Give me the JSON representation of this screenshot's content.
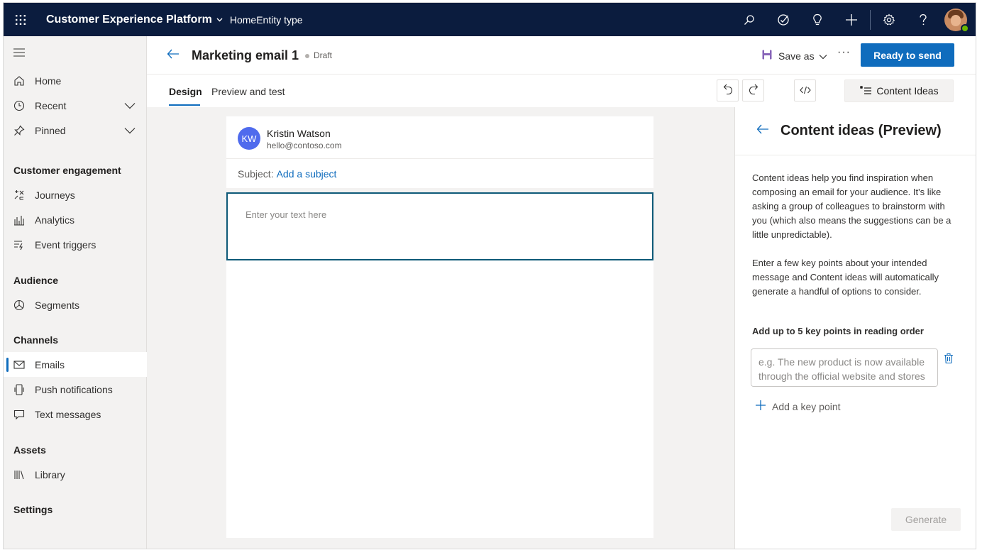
{
  "topbar": {
    "app_title": "Customer Experience Platform",
    "breadcrumb": "HomeEntity type",
    "colors": {
      "background": "#0b1c3e"
    }
  },
  "sidebar": {
    "top_items": [
      {
        "label": "Home",
        "icon": "home-icon"
      },
      {
        "label": "Recent",
        "icon": "clock-icon"
      },
      {
        "label": "Pinned",
        "icon": "pin-icon"
      }
    ],
    "groups": [
      {
        "title": "Customer engagement",
        "items": [
          {
            "label": "Journeys",
            "icon": "journeys-icon"
          },
          {
            "label": "Analytics",
            "icon": "analytics-icon"
          },
          {
            "label": "Event triggers",
            "icon": "event-triggers-icon"
          }
        ]
      },
      {
        "title": "Audience",
        "items": [
          {
            "label": "Segments",
            "icon": "segments-icon"
          }
        ]
      },
      {
        "title": "Channels",
        "items": [
          {
            "label": "Emails",
            "icon": "mail-icon",
            "active": true
          },
          {
            "label": "Push notifications",
            "icon": "push-notification-icon"
          },
          {
            "label": "Text messages",
            "icon": "chat-icon"
          }
        ]
      },
      {
        "title": "Assets",
        "items": [
          {
            "label": "Library",
            "icon": "library-icon"
          }
        ]
      },
      {
        "title": "Settings",
        "items": []
      }
    ]
  },
  "header": {
    "title": "Marketing email 1",
    "status": "Draft",
    "save_as": "Save as",
    "more": "···",
    "primary_button": "Ready to send",
    "colors": {
      "primary": "#0f6cbd"
    }
  },
  "tabs": [
    {
      "label": "Design",
      "selected": true
    },
    {
      "label": "Preview and test",
      "selected": false
    }
  ],
  "toolbar": {
    "content_ideas_label": "Content Ideas"
  },
  "email": {
    "sender_initials": "KW",
    "sender_name": "Kristin Watson",
    "sender_email": "hello@contoso.com",
    "subject_label": "Subject:",
    "subject_link": "Add a subject",
    "text_placeholder": "Enter your text here"
  },
  "panel": {
    "title": "Content ideas (Preview)",
    "desc1": "Content ideas help you find inspiration when composing an email for your audience. It's like asking a group of colleagues to brainstorm with you (which also means the suggestions can be a little unpredictable).",
    "desc2": "Enter a few key points about your intended message and Content ideas will automatically generate a handful of options to consider.",
    "key_points_label": "Add up to 5 key points in reading order",
    "key_point_placeholder": "e.g. The new product is now available through the official website and stores",
    "add_key_point": "Add a key point",
    "generate": "Generate"
  }
}
